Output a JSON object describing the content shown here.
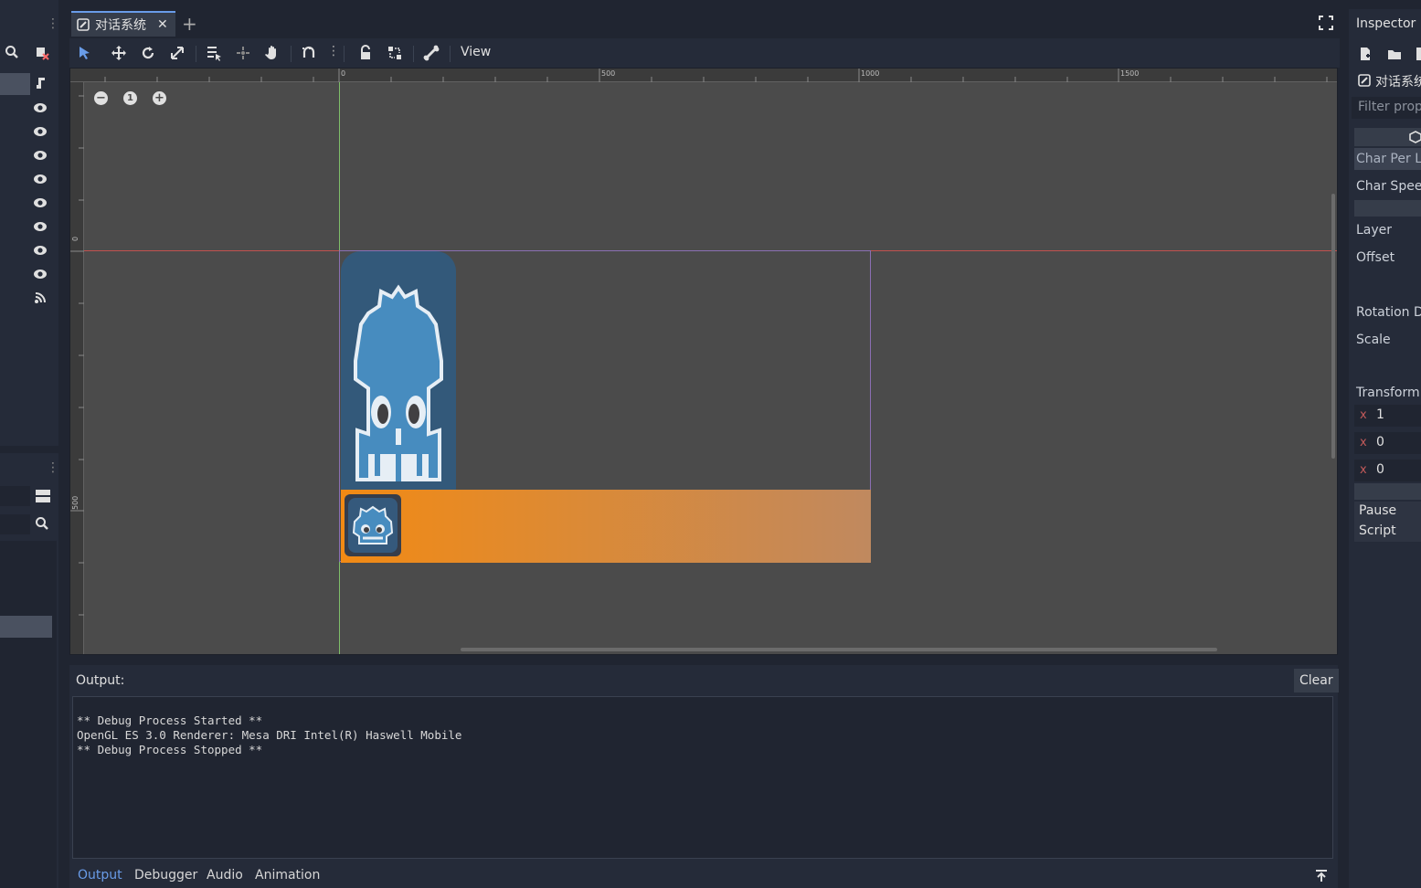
{
  "scene_tab": {
    "title": "对话系统",
    "close": "✕",
    "add": "+"
  },
  "toolbar": {
    "view_menu": "View"
  },
  "viewport": {
    "rulers": {
      "top": [
        "0",
        "500",
        "1000",
        "1500"
      ],
      "left": [
        "0",
        "500"
      ]
    },
    "zoom": {
      "minus": "−",
      "reset": "1",
      "plus": "+"
    }
  },
  "output": {
    "label": "Output:",
    "clear": "Clear",
    "lines": [
      "** Debug Process Started **",
      "OpenGL ES 3.0 Renderer: Mesa DRI Intel(R) Haswell Mobile",
      "** Debug Process Stopped **"
    ],
    "tabs": [
      "Output",
      "Debugger",
      "Audio",
      "Animation"
    ],
    "active_tab": "Output"
  },
  "inspector": {
    "title": "Inspector",
    "node_name": "对话系统",
    "filter_placeholder": "Filter prope",
    "props": [
      "Char Per Li",
      "Char Speed",
      "Layer",
      "Offset",
      "Rotation D",
      "Scale",
      "Transform"
    ],
    "transform": [
      {
        "axis": "x",
        "value": "1"
      },
      {
        "axis": "x",
        "value": "0"
      },
      {
        "axis": "x",
        "value": "0"
      }
    ],
    "sections": [
      "Pause",
      "Script"
    ]
  },
  "colors": {
    "accent": "#699ce8",
    "dialog_gradient_start": "#f28a14",
    "dialog_gradient_end": "#c0895f",
    "godot_blue": "#478cbf"
  }
}
